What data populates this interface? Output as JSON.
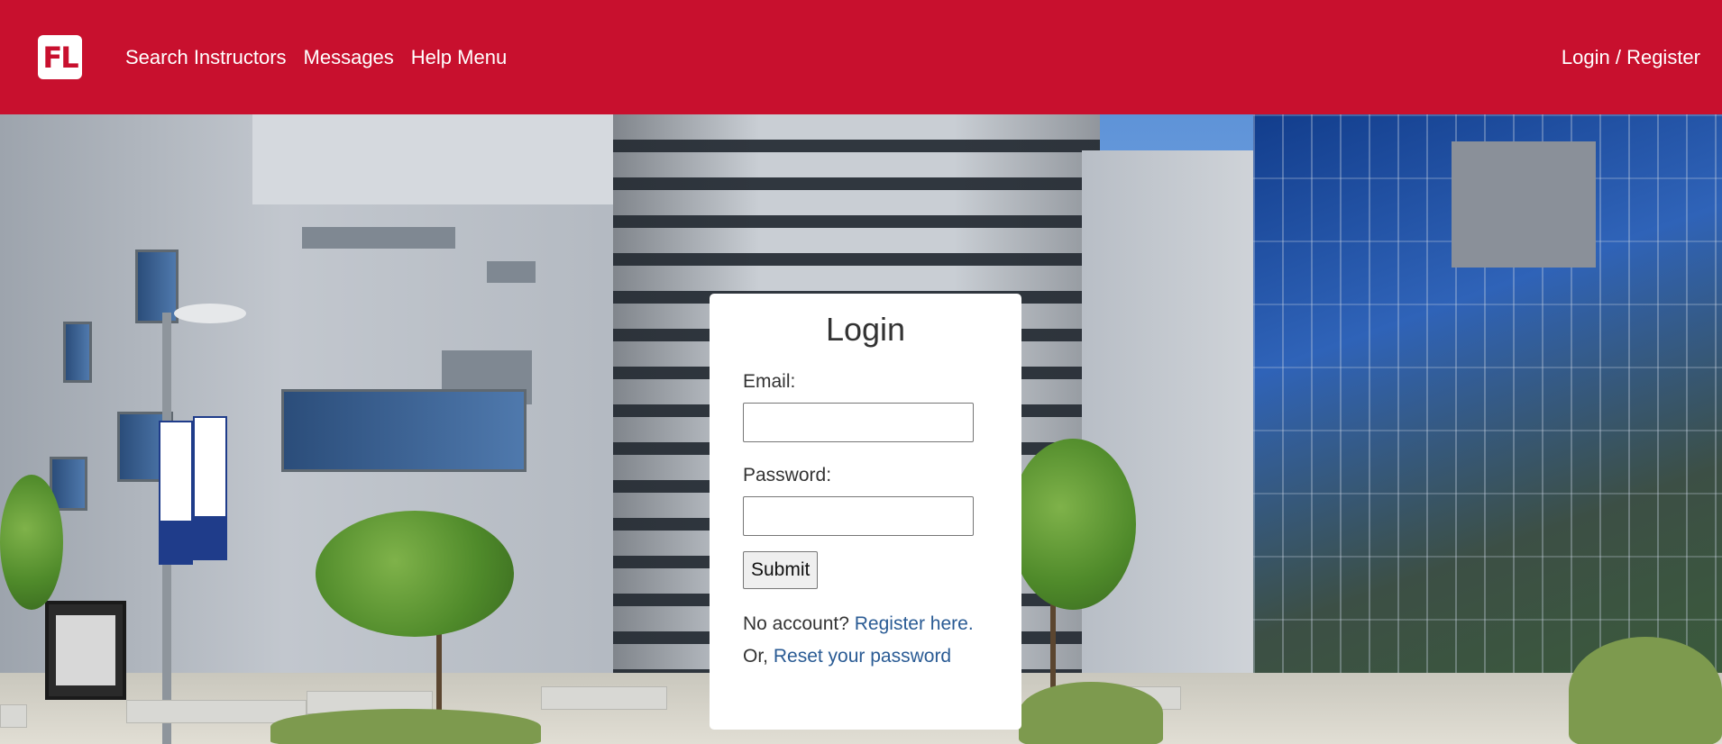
{
  "brand": {
    "logo_text": "FL"
  },
  "nav": {
    "links": [
      {
        "label": "Search Instructors"
      },
      {
        "label": "Messages"
      },
      {
        "label": "Help Menu"
      }
    ],
    "auth_link": "Login / Register"
  },
  "login": {
    "title": "Login",
    "email_label": "Email:",
    "email_value": "",
    "password_label": "Password:",
    "password_value": "",
    "submit_label": "Submit",
    "no_account_text": "No account?",
    "register_link": "Register here.",
    "reset_prefix": "Or,",
    "reset_link": "Reset your password"
  },
  "colors": {
    "navbar_bg": "#C8102E",
    "link_color": "#2a5b94"
  }
}
